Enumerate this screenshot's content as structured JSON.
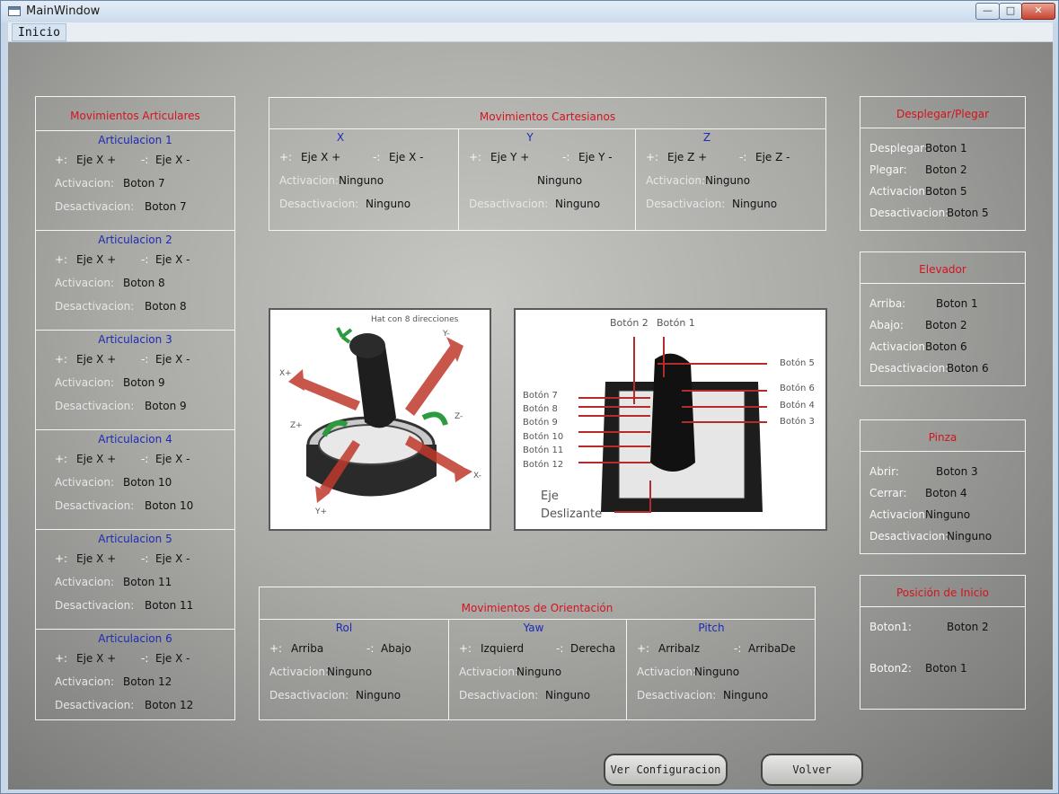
{
  "window": {
    "title": "MainWindow",
    "menu_inicio": "Inicio"
  },
  "articular": {
    "title": "Movimientos Articulares",
    "items": [
      {
        "title": "Articulacion 1",
        "plus": "+:",
        "minus": "-:",
        "eje_plus": "Eje X +",
        "eje_minus": "Eje X -",
        "act_label": "Activacion:",
        "act_value": "Boton 7",
        "des_label": "Desactivacion:",
        "des_value": "Boton 7"
      },
      {
        "title": "Articulacion 2",
        "plus": "+:",
        "minus": "-:",
        "eje_plus": "Eje X +",
        "eje_minus": "Eje X -",
        "act_label": "Activacion:",
        "act_value": "Boton 8",
        "des_label": "Desactivacion:",
        "des_value": "Boton 8"
      },
      {
        "title": "Articulacion 3",
        "plus": "+:",
        "minus": "-:",
        "eje_plus": "Eje X +",
        "eje_minus": "Eje X -",
        "act_label": "Activacion:",
        "act_value": "Boton 9",
        "des_label": "Desactivacion:",
        "des_value": "Boton 9"
      },
      {
        "title": "Articulacion 4",
        "plus": "+:",
        "minus": "-:",
        "eje_plus": "Eje X +",
        "eje_minus": "Eje X -",
        "act_label": "Activacion:",
        "act_value": "Boton 10",
        "des_label": "Desactivacion:",
        "des_value": "Boton 10"
      },
      {
        "title": "Articulacion 5",
        "plus": "+:",
        "minus": "-:",
        "eje_plus": "Eje X +",
        "eje_minus": "Eje X -",
        "act_label": "Activacion:",
        "act_value": "Boton 11",
        "des_label": "Desactivacion:",
        "des_value": "Boton 11"
      },
      {
        "title": "Articulacion 6",
        "plus": "+:",
        "minus": "-:",
        "eje_plus": "Eje X +",
        "eje_minus": "Eje X -",
        "act_label": "Activacion:",
        "act_value": "Boton 12",
        "des_label": "Desactivacion:",
        "des_value": "Boton 12"
      }
    ]
  },
  "cartesian": {
    "title": "Movimientos Cartesianos",
    "cols": [
      {
        "title": "X",
        "plus": "+:",
        "minus": "-:",
        "eje_plus": "Eje X +",
        "eje_minus": "Eje X -",
        "act_label": "Activacion:",
        "act_value": "Ninguno",
        "des_label": "Desactivacion:",
        "des_value": "Ninguno"
      },
      {
        "title": "Y",
        "plus": "+:",
        "minus": "-:",
        "eje_plus": "Eje Y +",
        "eje_minus": "Eje Y -",
        "act_label": "",
        "act_value": "Ninguno",
        "des_label": "Desactivacion:",
        "des_value": "Ninguno"
      },
      {
        "title": "Z",
        "plus": "+:",
        "minus": "-:",
        "eje_plus": "Eje Z +",
        "eje_minus": "Eje Z -",
        "act_label": "Activacion:",
        "act_value": "Ninguno",
        "des_label": "Desactivacion:",
        "des_value": "Ninguno"
      }
    ]
  },
  "orientation": {
    "title": "Movimientos de Orientación",
    "cols": [
      {
        "title": "Rol",
        "plus": "+:",
        "minus": "-:",
        "eje_plus": "Arriba",
        "eje_minus": "Abajo",
        "act_label": "Activacion:",
        "act_value": "Ninguno",
        "des_label": "Desactivacion:",
        "des_value": "Ninguno"
      },
      {
        "title": "Yaw",
        "plus": "+:",
        "minus": "-:",
        "eje_plus": "Izquierd",
        "eje_minus": "Derecha",
        "act_label": "Activacion:",
        "act_value": "Ninguno",
        "des_label": "Desactivacion:",
        "des_value": "Ninguno"
      },
      {
        "title": "Pitch",
        "plus": "+:",
        "minus": "-:",
        "eje_plus": "ArribaIz",
        "eje_minus": "ArribaDe",
        "act_label": "Activacion:",
        "act_value": "Ninguno",
        "des_label": "Desactivacion:",
        "des_value": "Ninguno"
      }
    ]
  },
  "desplegar": {
    "title": "Desplegar/Plegar",
    "rows": [
      {
        "label": "Desplegar:",
        "value": "Boton 1"
      },
      {
        "label": "Plegar:",
        "value": "Boton 2"
      },
      {
        "label": "Activacion:",
        "value": "Boton 5"
      },
      {
        "label": "Desactivacion:",
        "value": "Boton 5"
      }
    ]
  },
  "elevador": {
    "title": "Elevador",
    "rows": [
      {
        "label": "Arriba:",
        "value": "Boton 1"
      },
      {
        "label": "Abajo:",
        "value": "Boton 2"
      },
      {
        "label": "Activacion:",
        "value": "Boton 6"
      },
      {
        "label": "Desactivacion:",
        "value": "Boton 6"
      }
    ]
  },
  "pinza": {
    "title": "Pinza",
    "rows": [
      {
        "label": "Abrir:",
        "value": "Boton 3"
      },
      {
        "label": "Cerrar:",
        "value": "Boton 4"
      },
      {
        "label": "Activacion:",
        "value": "Ninguno"
      },
      {
        "label": "Desactivacion:",
        "value": "Ninguno"
      }
    ]
  },
  "inicio": {
    "title": "Posición de Inicio",
    "rows": [
      {
        "label": "Boton1:",
        "value": "Boton 2"
      },
      {
        "label": "Boton2:",
        "value": "Boton 1"
      }
    ]
  },
  "img1": {
    "hat": "Hat con 8 direcciones",
    "x_plus": "X+",
    "x_minus": "X-",
    "y_plus": "Y+",
    "y_minus": "Y-",
    "z_plus": "Z+",
    "z_minus": "Z-"
  },
  "img2": {
    "top": [
      "Botón 2",
      "Botón 1"
    ],
    "right": [
      "Botón 5",
      "Botón 6",
      "Botón 4",
      "Botón 3"
    ],
    "left": [
      "Botón 7",
      "Botón 8",
      "Botón 9",
      "Botón 10",
      "Botón 11",
      "Botón 12"
    ],
    "eje": "Eje",
    "deslizante": "Deslizante"
  },
  "buttons": {
    "ver": "Ver Configuracion",
    "volver": "Volver"
  }
}
